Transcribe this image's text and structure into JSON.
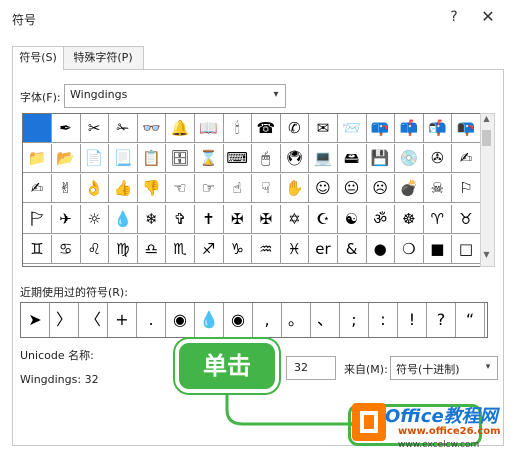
{
  "window": {
    "title": "符号",
    "help_glyph": "?",
    "close_glyph": "✕"
  },
  "tabs": [
    {
      "label": "符号(S)",
      "active": true
    },
    {
      "label": "特殊字符(P)",
      "active": false
    }
  ],
  "font": {
    "label": "字体(F):",
    "value": "Wingdings"
  },
  "grid_rows": [
    [
      "",
      "✒",
      "✂",
      "✁",
      "👓",
      "🔔",
      "📖",
      "🕯",
      "☎",
      "✆",
      "✉",
      "📨",
      "📪",
      "📫",
      "📬",
      "📭"
    ],
    [
      "📁",
      "📂",
      "📄",
      "📃",
      "📋",
      "🗄",
      "⌛",
      "⌨",
      "🖱",
      "🖲",
      "💻",
      "🖴",
      "💾",
      "💿",
      "✇",
      "✍"
    ],
    [
      "✍",
      "✌",
      "👌",
      "👍",
      "👎",
      "☜",
      "☞",
      "☝",
      "☟",
      "✋",
      "☺",
      "😐",
      "☹",
      "💣",
      "☠",
      "⚐"
    ],
    [
      "🏱",
      "✈",
      "☼",
      "💧",
      "❄",
      "✞",
      "✝",
      "✠",
      "✠",
      "✡",
      "☪",
      "☯",
      "ॐ",
      "☸",
      "♈",
      "♉"
    ],
    [
      "♊",
      "♋",
      "♌",
      "♍",
      "♎",
      "♏",
      "♐",
      "♑",
      "♒",
      "♓",
      "er",
      "&",
      "●",
      "❍",
      "■",
      "□"
    ]
  ],
  "recent": {
    "label": "近期使用过的符号(R):",
    "symbols": [
      "➤",
      "〉",
      "〈",
      "+",
      ".",
      "◉",
      "💧",
      "◉",
      ",",
      "。",
      "、",
      ";",
      ":",
      "!",
      "?",
      "“"
    ]
  },
  "unicode": {
    "name_label": "Unicode 名称:",
    "name_value": "Wingdings: 32"
  },
  "code": {
    "value": "32"
  },
  "from": {
    "label": "来自(M):",
    "value": "符号(十进制)"
  },
  "callout": {
    "text": "单击"
  },
  "watermark": {
    "brand": "Office教程网",
    "url1": "www.office26.com",
    "url2": "www.excelcw.com"
  },
  "colors": {
    "selection": "#1e74d8",
    "callout": "#43b548",
    "watermark_orange": "#ff7b00"
  }
}
